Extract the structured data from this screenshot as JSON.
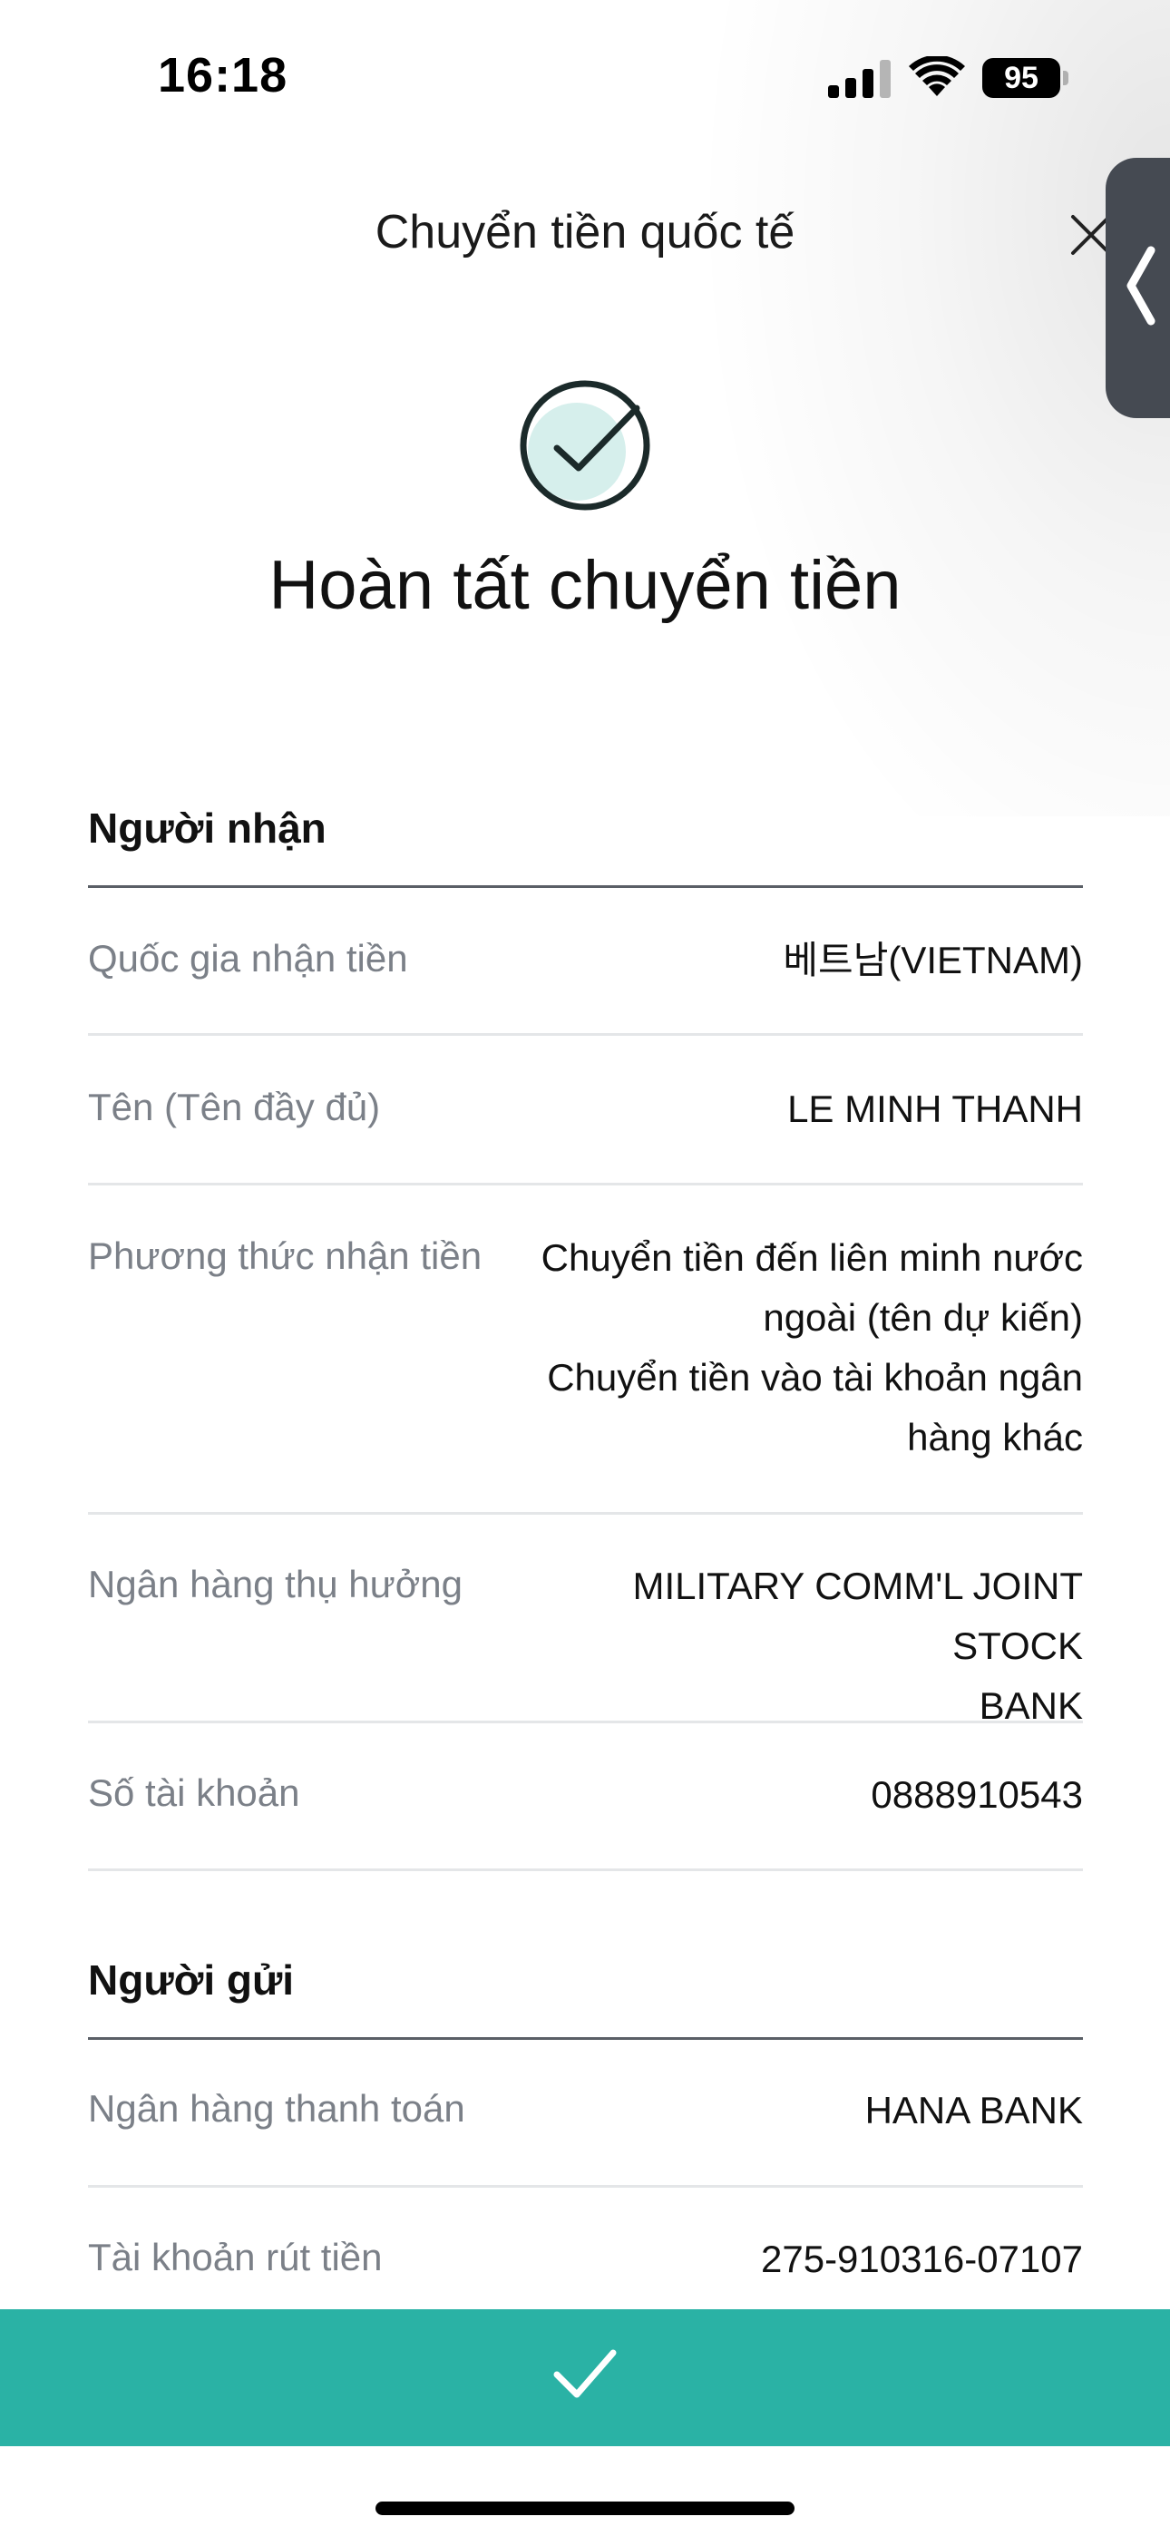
{
  "status_bar": {
    "time": "16:18",
    "battery": "95",
    "icons": [
      "cellular-signal-icon",
      "wifi-icon",
      "battery-icon"
    ]
  },
  "header": {
    "title": "Chuyển tiền quốc tế",
    "close_icon": "close-icon",
    "side_tab_icon": "chevron-left-icon"
  },
  "result": {
    "icon": "check-circle-icon",
    "title": "Hoàn tất chuyển tiền"
  },
  "recipient": {
    "section_title": "Người nhận",
    "rows": [
      {
        "label": "Quốc gia nhận tiền",
        "value_lines": [
          "베트남(VIETNAM)"
        ]
      },
      {
        "label": "Tên (Tên đầy đủ)",
        "value_lines": [
          "LE MINH THANH"
        ]
      },
      {
        "label": "Phương thức nhận tiền",
        "value_lines": [
          "Chuyển tiền đến liên minh nước",
          "ngoài (tên dự kiến)",
          "Chuyển tiền vào tài khoản ngân",
          "hàng khác"
        ]
      },
      {
        "label": "Ngân hàng thụ hưởng",
        "value_lines": [
          "MILITARY COMM'L JOINT STOCK",
          "BANK"
        ]
      },
      {
        "label": "Số tài khoản",
        "value_lines": [
          "0888910543"
        ]
      }
    ]
  },
  "sender": {
    "section_title": "Người gửi",
    "rows": [
      {
        "label": "Ngân hàng thanh toán",
        "value_lines": [
          "HANA BANK"
        ]
      },
      {
        "label": "Tài khoản rút tiền",
        "value_lines": [
          "275-910316-07107"
        ]
      }
    ]
  },
  "footer": {
    "confirm_icon": "checkmark-icon"
  },
  "colors": {
    "accent": "#2ab2a5",
    "check_fill": "#d6efec",
    "label_gray": "#7b8088",
    "divider": "#e4e6e8"
  }
}
